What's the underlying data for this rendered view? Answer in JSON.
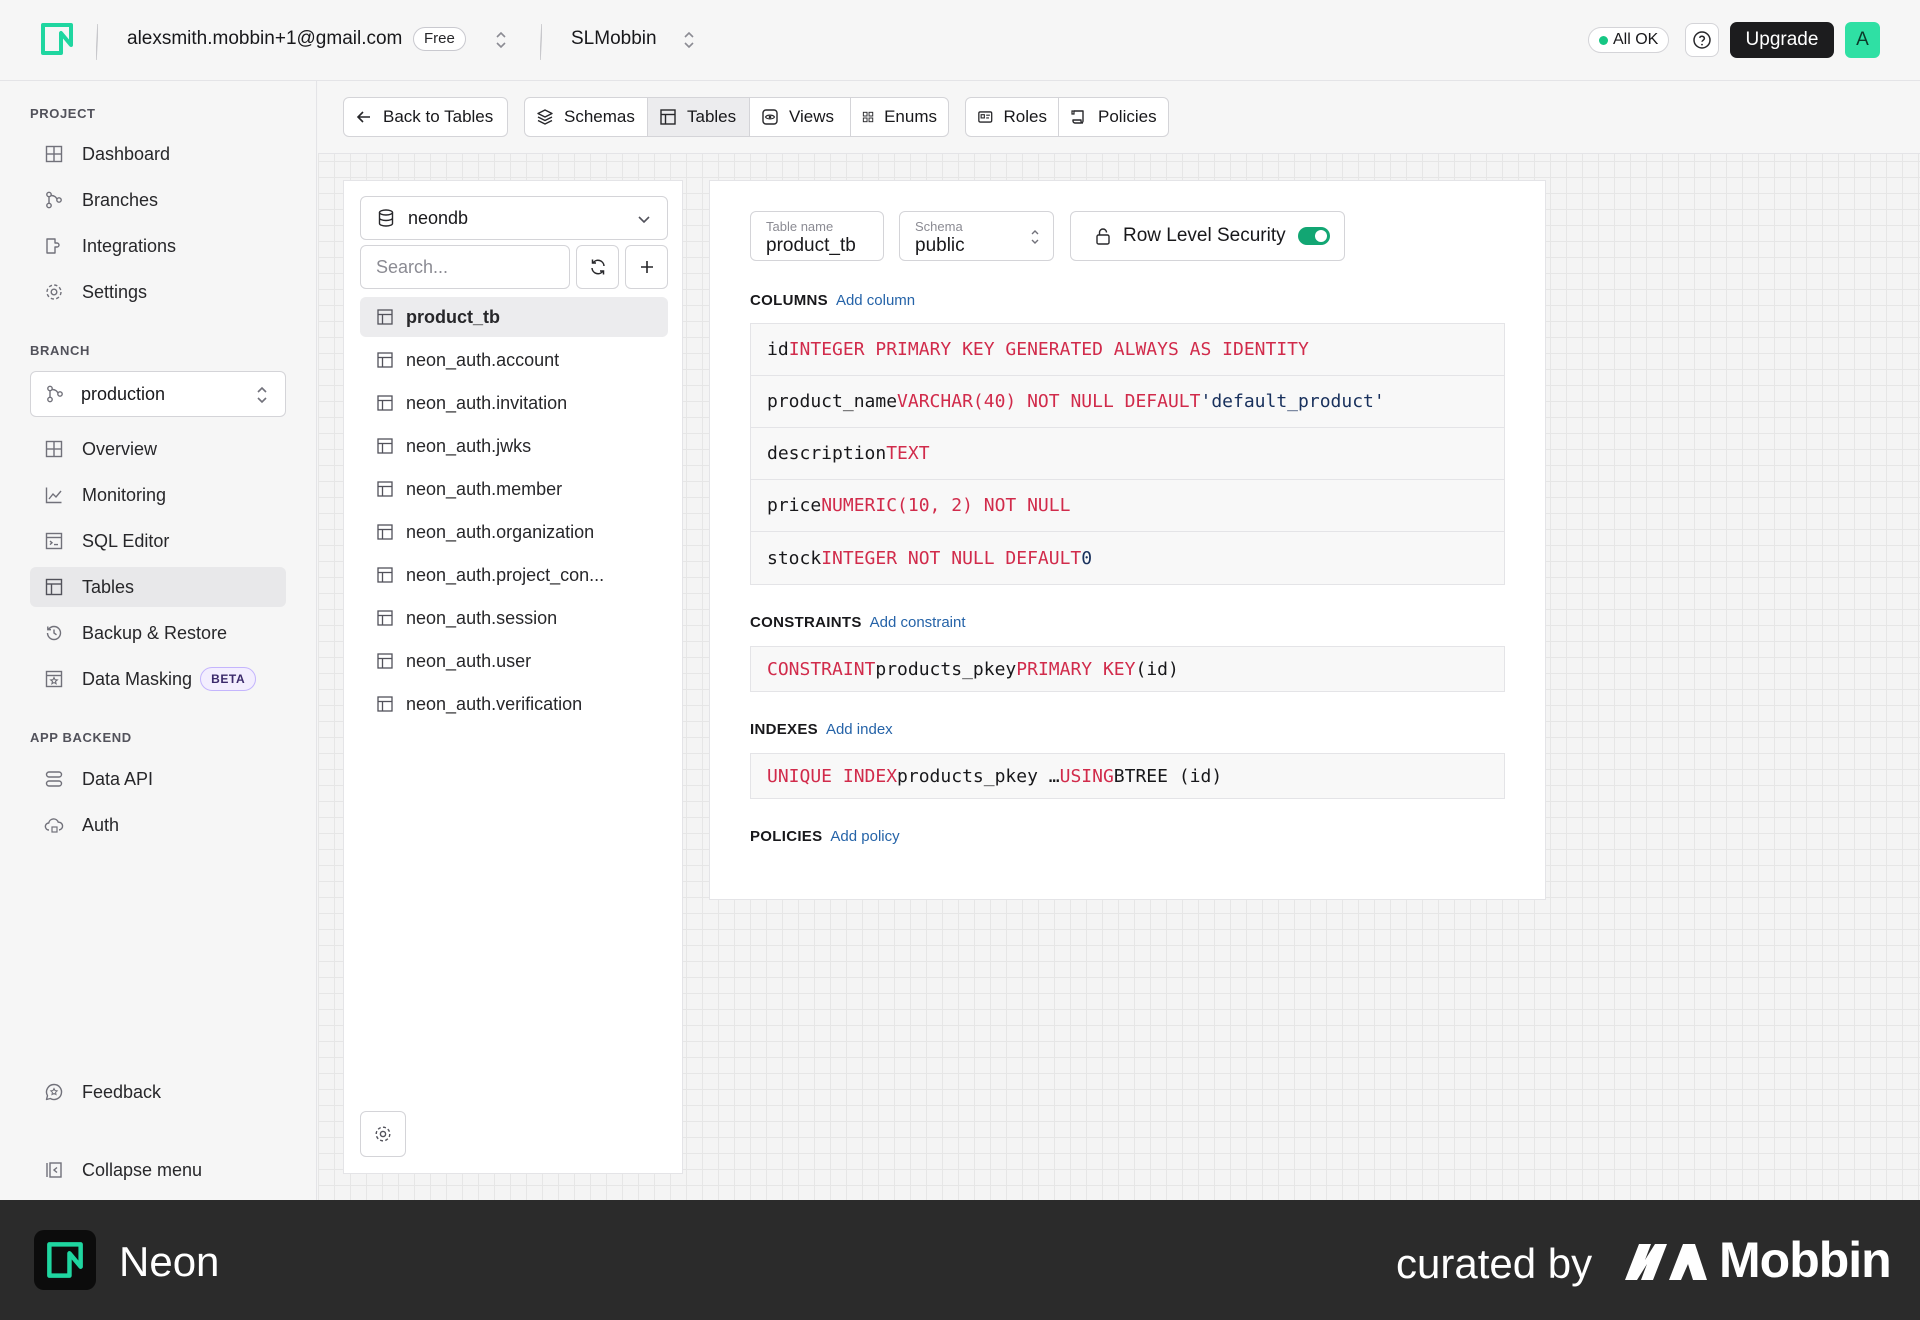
{
  "header": {
    "email": "alexsmith.mobbin+1@gmail.com",
    "plan_badge": "Free",
    "project": "SLMobbin",
    "status": "All OK",
    "upgrade_label": "Upgrade",
    "avatar_letter": "A"
  },
  "sidebar": {
    "project_label": "PROJECT",
    "project_items": [
      "Dashboard",
      "Branches",
      "Integrations",
      "Settings"
    ],
    "branch_label": "BRANCH",
    "branch_value": "production",
    "branch_items": [
      "Overview",
      "Monitoring",
      "SQL Editor",
      "Tables",
      "Backup & Restore",
      "Data Masking"
    ],
    "beta_badge": "BETA",
    "app_backend_label": "APP BACKEND",
    "app_backend_items": [
      "Data API",
      "Auth"
    ],
    "feedback": "Feedback",
    "collapse": "Collapse menu"
  },
  "toolbar": {
    "back": "Back to Tables",
    "schemas": "Schemas",
    "tables": "Tables",
    "views": "Views",
    "enums": "Enums",
    "roles": "Roles",
    "policies": "Policies"
  },
  "table_list": {
    "database": "neondb",
    "search_placeholder": "Search...",
    "items": [
      "product_tb",
      "neon_auth.account",
      "neon_auth.invitation",
      "neon_auth.jwks",
      "neon_auth.member",
      "neon_auth.organization",
      "neon_auth.project_con...",
      "neon_auth.session",
      "neon_auth.user",
      "neon_auth.verification"
    ]
  },
  "detail": {
    "table_name_label": "Table name",
    "table_name": "product_tb",
    "schema_label": "Schema",
    "schema": "public",
    "rls_label": "Row Level Security",
    "columns_label": "COLUMNS",
    "add_column": "Add column",
    "columns": [
      {
        "name": "id",
        "def": "INTEGER PRIMARY KEY GENERATED ALWAYS AS IDENTITY",
        "default": ""
      },
      {
        "name": "product_name",
        "def": "VARCHAR(40) NOT NULL DEFAULT",
        "default": "'default_product'"
      },
      {
        "name": "description",
        "def": "TEXT",
        "default": ""
      },
      {
        "name": "price",
        "def": "NUMERIC(10, 2) NOT NULL",
        "default": ""
      },
      {
        "name": "stock",
        "def": "INTEGER NOT NULL DEFAULT",
        "default": "0"
      }
    ],
    "constraints_label": "CONSTRAINTS",
    "add_constraint": "Add constraint",
    "constraint": {
      "kw1": "CONSTRAINT",
      "name": "products_pkey",
      "kw2": "PRIMARY KEY",
      "cols": "(id)"
    },
    "indexes_label": "INDEXES",
    "add_index": "Add index",
    "index": {
      "kw1": "UNIQUE INDEX",
      "name": "products_pkey …",
      "kw2": "USING",
      "method": "BTREE (id)"
    },
    "policies_label": "POLICIES",
    "add_policy": "Add policy"
  },
  "footer": {
    "brand": "Neon",
    "curated": "curated by",
    "mobbin": "Mobbin"
  },
  "colors": {
    "accent": "#16c784",
    "keyword": "#d12b4b",
    "link": "#2563a8",
    "footer_bg": "#2b2b2b"
  }
}
